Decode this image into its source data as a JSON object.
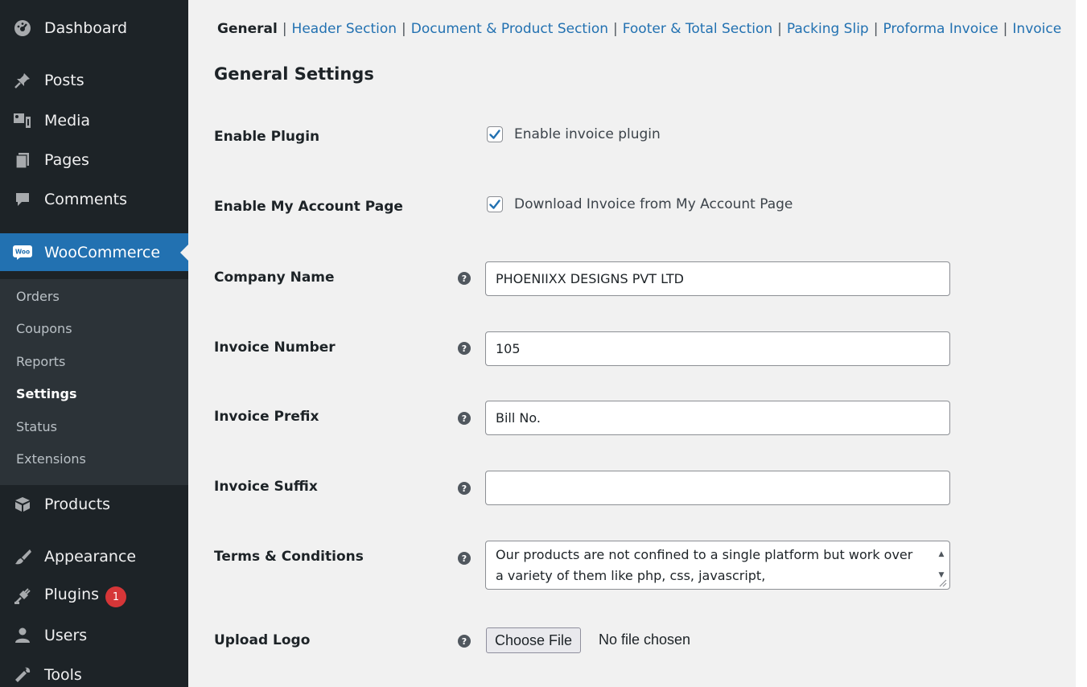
{
  "sidebar": {
    "menu": [
      {
        "label": "Dashboard",
        "icon": "dashboard-icon"
      },
      {
        "label": "Posts",
        "icon": "pin-icon"
      },
      {
        "label": "Media",
        "icon": "media-icon"
      },
      {
        "label": "Pages",
        "icon": "pages-icon"
      },
      {
        "label": "Comments",
        "icon": "comment-icon"
      },
      {
        "label": "WooCommerce",
        "icon": "woo-icon"
      },
      {
        "label": "Products",
        "icon": "box-icon"
      },
      {
        "label": "Appearance",
        "icon": "brush-icon"
      },
      {
        "label": "Plugins",
        "icon": "plug-icon",
        "badge": "1"
      },
      {
        "label": "Users",
        "icon": "user-icon"
      },
      {
        "label": "Tools",
        "icon": "wrench-icon"
      }
    ],
    "woo_icon_text": "Woo",
    "submenu": [
      "Orders",
      "Coupons",
      "Reports",
      "Settings",
      "Status",
      "Extensions"
    ],
    "current_submenu": "Settings",
    "active_color": "#2271b1",
    "badge_color": "#d63638"
  },
  "tabs": [
    "General",
    "Header Section",
    "Document & Product Section",
    "Footer & Total Section",
    "Packing Slip",
    "Proforma Invoice",
    "Invoice"
  ],
  "current_tab": "General",
  "section_title": "General Settings",
  "fields": {
    "enable_plugin": {
      "label": "Enable Plugin",
      "checkbox_label": "Enable invoice plugin",
      "checked": true
    },
    "enable_account": {
      "label": "Enable My Account Page",
      "checkbox_label": "Download Invoice from My Account Page",
      "checked": true
    },
    "company_name": {
      "label": "Company Name",
      "value": "PHOENIIXX DESIGNS PVT LTD"
    },
    "invoice_number": {
      "label": "Invoice Number",
      "value": "105"
    },
    "invoice_prefix": {
      "label": "Invoice Prefix",
      "value": "Bill No."
    },
    "invoice_suffix": {
      "label": "Invoice Suffix",
      "value": ""
    },
    "terms": {
      "label": "Terms & Conditions",
      "value": "Our products are not confined to a single platform but work over a variety of them like php, css, javascript,"
    },
    "upload_logo": {
      "label": "Upload Logo",
      "button": "Choose File",
      "status": "No file chosen"
    }
  },
  "help_glyph": "?"
}
